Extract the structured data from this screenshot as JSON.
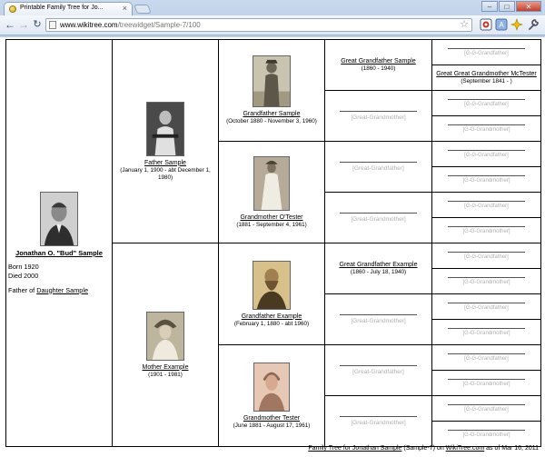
{
  "browser": {
    "tab_title": "Printable Family Tree for Jo...",
    "url_host": "www.wikitree.com",
    "url_path": "/treewidget/Sample-7/100"
  },
  "root": {
    "name": "Jonathan O. \"Bud\" Sample",
    "born": "Born 1920",
    "died": "Died 2000",
    "father_of_prefix": "Father of ",
    "father_of_link": "Daughter Sample"
  },
  "parents": {
    "father": {
      "name": "Father Sample",
      "dates": "(January 1, 1900 - abt December 1, 1980)"
    },
    "mother": {
      "name": "Mother Example",
      "dates": "(1901 - 1981)"
    }
  },
  "grandparents": {
    "gf1": {
      "name": "Grandfather Sample",
      "dates": "(October 1880 - November 3, 1960)"
    },
    "gm1": {
      "name": "Grandmother O'Tester",
      "dates": "(1881 - September 4, 1961)"
    },
    "gf2": {
      "name": "Grandfather Example",
      "dates": "(February 1, 1880 - abt 1960)"
    },
    "gm2": {
      "name": "Grandmother Tester",
      "dates": "(June 1881 - August 17, 1961)"
    }
  },
  "great_grandparents": {
    "ggf1": {
      "name": "Great Grandfather Sample",
      "dates": "(1860 - 1940)"
    },
    "ggf3": {
      "name": "Great Grandfather Example",
      "dates": "(1860 - July 18, 1940)"
    },
    "placeholder_gf": "[Great-Grandfather]",
    "placeholder_gm": "[Great-Grandmother]"
  },
  "gg_grandparents": {
    "known": {
      "name": "Great Great Grandmother McTester",
      "dates": "(September 1841 - )"
    },
    "placeholder_gf": "[G-G-Grandfather]",
    "placeholder_gm": "[G-G-Grandmother]"
  },
  "footer": {
    "link": "Family Tree for Jonathan Sample",
    "id_text": " (Sample-7) on ",
    "site": "WikiTree.com",
    "date_text": " as of Mar 16, 2011"
  }
}
